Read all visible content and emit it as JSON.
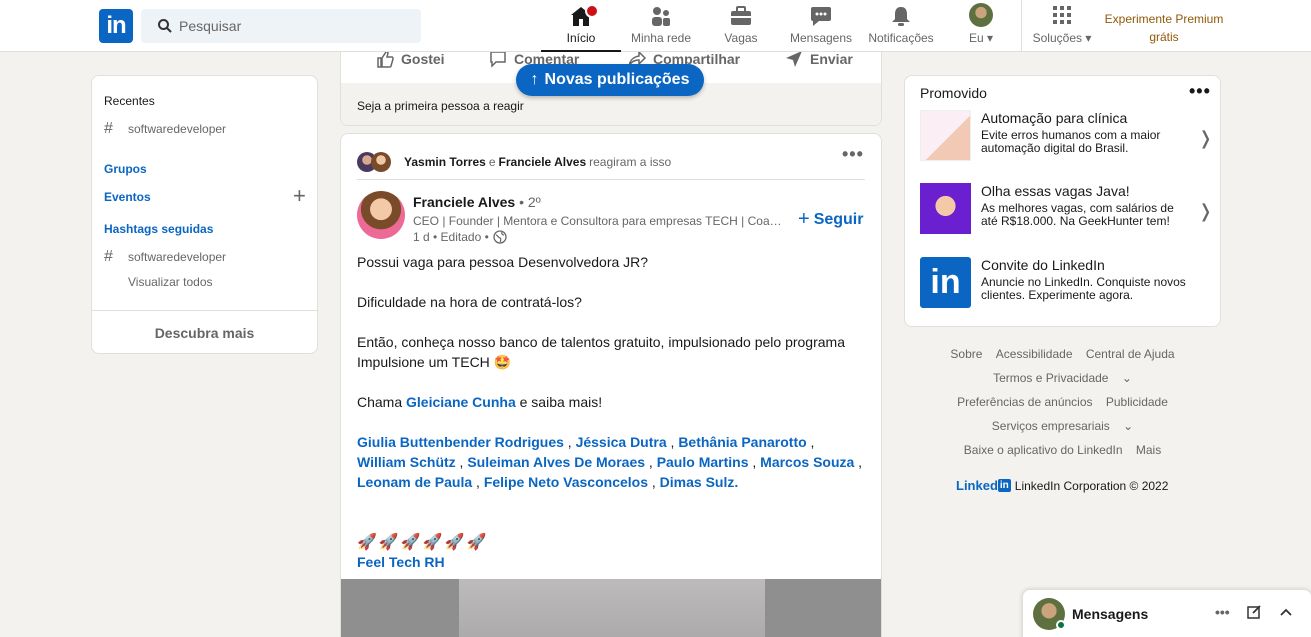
{
  "header": {
    "logo_text": "in",
    "search_placeholder": "Pesquisar",
    "nav": [
      {
        "label": "Início",
        "icon": "home-icon"
      },
      {
        "label": "Minha rede",
        "icon": "network-icon"
      },
      {
        "label": "Vagas",
        "icon": "briefcase-icon"
      },
      {
        "label": "Mensagens",
        "icon": "messaging-icon"
      },
      {
        "label": "Notificações",
        "icon": "bell-icon"
      },
      {
        "label": "Eu",
        "icon": "avatar"
      },
      {
        "label": "Soluções",
        "icon": "grid-icon"
      }
    ],
    "premium_line1": "Experimente Premium",
    "premium_line2": "grátis"
  },
  "left_sidebar": {
    "recent_title": "Recentes",
    "recent_items": [
      "softwaredeveloper"
    ],
    "groups": "Grupos",
    "events": "Eventos",
    "hashtags_title": "Hashtags seguidas",
    "hashtags": [
      "softwaredeveloper"
    ],
    "view_all": "Visualizar todos",
    "discover": "Descubra mais"
  },
  "prev_post": {
    "actions": [
      "Gostei",
      "Comentar",
      "Compartilhar",
      "Enviar"
    ],
    "react_prompt": "Seja a primeira pessoa a reagir"
  },
  "new_posts_pill": "Novas publicações",
  "post": {
    "reacted_by_1": "Yasmin Torres",
    "reacted_and": "e",
    "reacted_by_2": "Franciele Alves",
    "reacted_suffix": "reagiram a isso",
    "author": "Franciele Alves",
    "degree": "• 2º",
    "headline": "CEO | Founder | Mentora e Consultora para empresas TECH | Coach …",
    "time": "1 d • Editado •",
    "follow": "Seguir",
    "line1": "Possui vaga para pessoa Desenvolvedora JR?",
    "line2": "Dificuldade na hora de contratá-los?",
    "line3": "Então, conheça nosso banco de talentos gratuito, impulsionado pelo programa Impulsione um TECH",
    "line4_pre": "Chama",
    "line4_mention": "Gleiciane Cunha",
    "line4_post": "e saiba mais!",
    "mentions": [
      "Giulia Buttenbender Rodrigues",
      "Jéssica Dutra",
      "Bethânia Panarotto",
      "William Schütz",
      "Suleiman Alves De Moraes",
      "Paulo Martins",
      "Marcos Souza",
      "Leonam de Paula",
      "Felipe Neto Vasconcelos",
      "Dimas Sulz."
    ],
    "rockets": [
      "🚀",
      "🚀",
      "🚀",
      "🚀",
      "🚀",
      "🚀"
    ],
    "company": "Feel Tech RH"
  },
  "promo": {
    "title": "Promovido",
    "items": [
      {
        "headline": "Automação para clínica",
        "desc": "Evite erros humanos com a maior automação digital do Brasil."
      },
      {
        "headline": "Olha essas vagas Java!",
        "desc": "As melhores vagas, com salários de até R$18.000. Na GeekHunter tem!"
      },
      {
        "headline": "Convite do LinkedIn",
        "desc": "Anuncie no LinkedIn. Conquiste novos clientes. Experimente agora."
      }
    ]
  },
  "footer": {
    "links": [
      "Sobre",
      "Acessibilidade",
      "Central de Ajuda",
      "Termos e Privacidade",
      "Preferências de anúncios",
      "Publicidade",
      "Serviços empresariais",
      "Baixe o aplicativo do LinkedIn",
      "Mais"
    ],
    "brand_word": "Linked",
    "brand_in": "in",
    "copyright": "LinkedIn Corporation © 2022"
  },
  "messaging": {
    "title": "Mensagens"
  },
  "colors": {
    "brand": "#0a66c2",
    "premium": "#915907",
    "notification": "#cc1016",
    "online": "#057642"
  }
}
